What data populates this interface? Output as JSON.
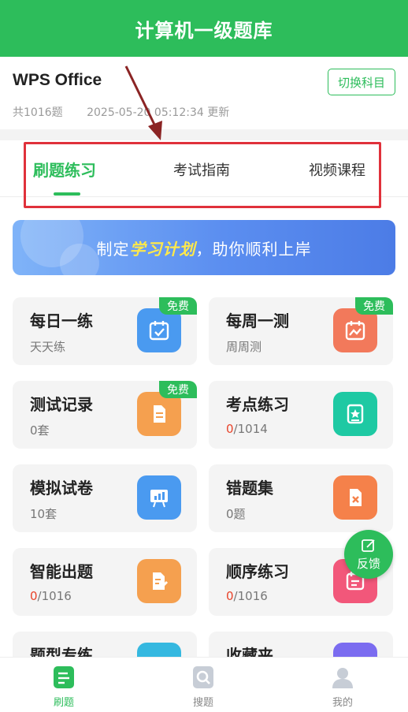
{
  "header": {
    "title": "计算机一级题库"
  },
  "subject": {
    "name": "WPS Office",
    "switch_label": "切换科目",
    "count": "共1016题",
    "updated": "2025-05-20 05:12:34 更新"
  },
  "tabs": [
    {
      "label": "刷题练习",
      "active": true
    },
    {
      "label": "考试指南",
      "active": false
    },
    {
      "label": "视频课程",
      "active": false
    }
  ],
  "banner": {
    "prefix": "制定",
    "highlight": "学习计划",
    "suffix": "，助你顺利上岸"
  },
  "cards": [
    {
      "title": "每日一练",
      "sub": "天天练",
      "free": "免费",
      "icon": "calendar-check-icon",
      "color": "#4a9af0"
    },
    {
      "title": "每周一测",
      "sub": "周周测",
      "free": "免费",
      "icon": "calendar-chart-icon",
      "color": "#f2795b"
    },
    {
      "title": "测试记录",
      "sub": "0套",
      "free": "免费",
      "icon": "document-icon",
      "color": "#f5a04f"
    },
    {
      "title": "考点练习",
      "sub_red": "0",
      "sub_rest": "/1014",
      "icon": "star-book-icon",
      "color": "#1ec9a3"
    },
    {
      "title": "模拟试卷",
      "sub": "10套",
      "icon": "presentation-chart-icon",
      "color": "#4a9af0"
    },
    {
      "title": "错题集",
      "sub": "0题",
      "icon": "wrong-file-icon",
      "color": "#f5814a"
    },
    {
      "title": "智能出题",
      "sub_red": "0",
      "sub_rest": "/1016",
      "icon": "edit-document-icon",
      "color": "#f5a04f"
    },
    {
      "title": "顺序练习",
      "sub_red": "0",
      "sub_rest": "/1016",
      "icon": "list-calendar-icon",
      "color": "#f2577a"
    },
    {
      "title": "题型专练",
      "icon": "category-icon",
      "color": "#35b8e0"
    },
    {
      "title": "收藏夹",
      "icon": "favorite-icon",
      "color": "#7b6cf0"
    }
  ],
  "feedback": {
    "label": "反馈"
  },
  "nav": [
    {
      "label": "刷题",
      "active": true
    },
    {
      "label": "搜题",
      "active": false
    },
    {
      "label": "我的",
      "active": false
    }
  ],
  "colors": {
    "accent": "#2dbd5b",
    "highlight_box": "#e0313b",
    "arrow": "#8b2424"
  }
}
